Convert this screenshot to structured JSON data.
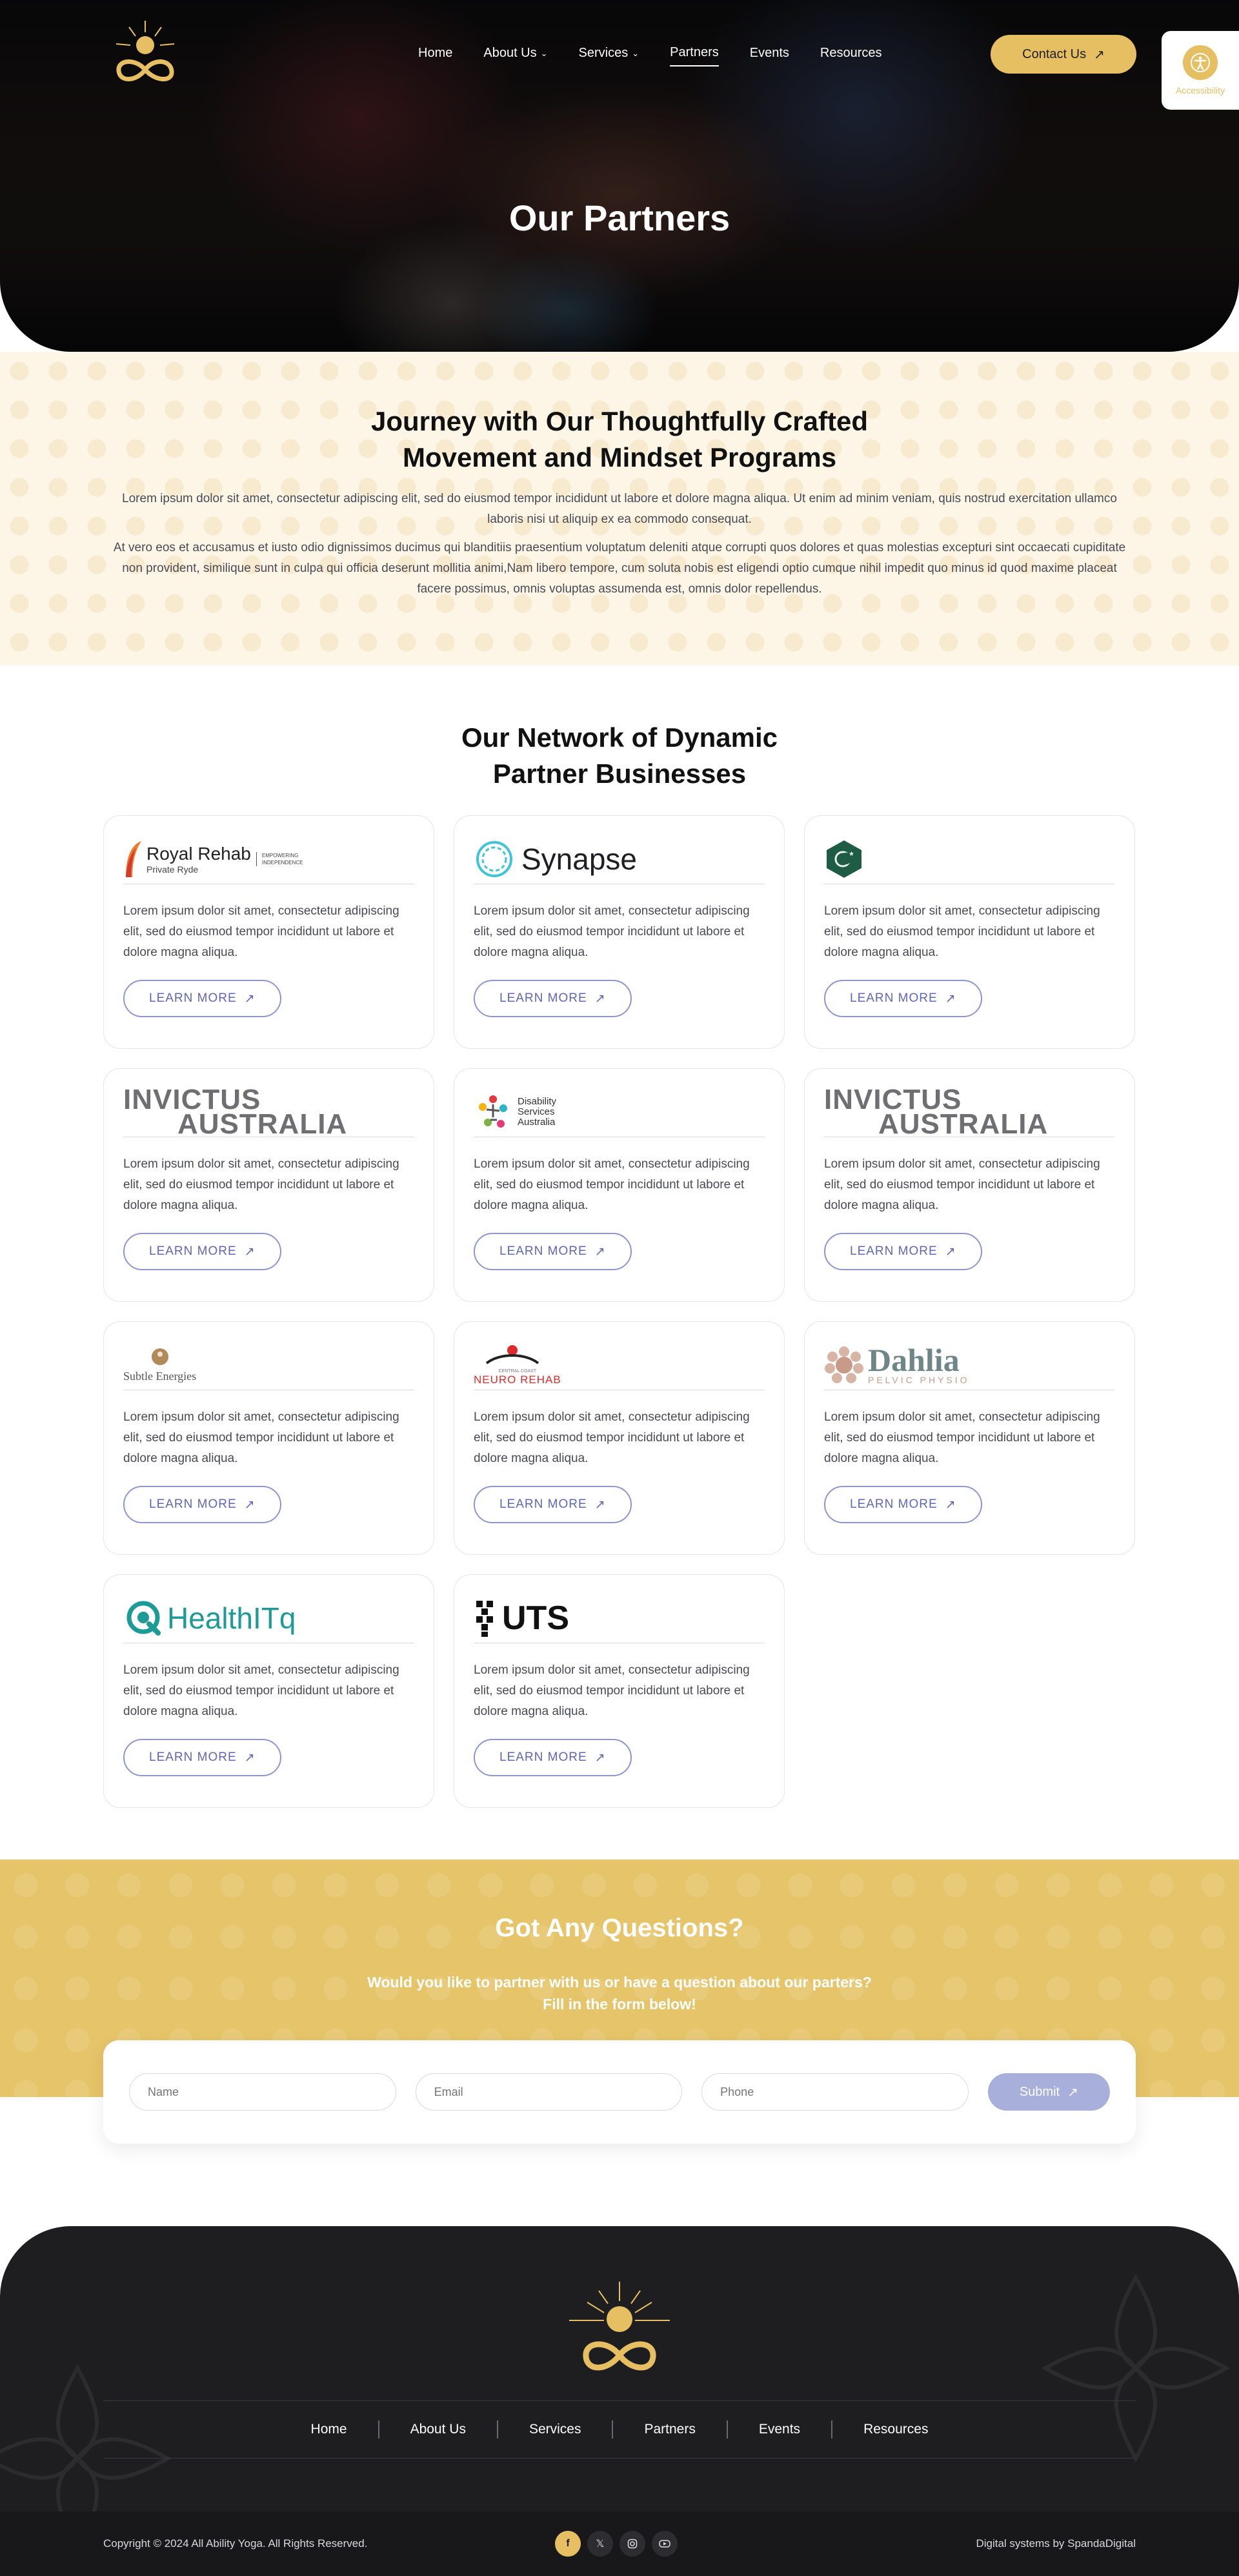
{
  "header": {
    "nav": [
      {
        "label": "Home",
        "dropdown": false,
        "active": false
      },
      {
        "label": "About Us",
        "dropdown": true,
        "active": false
      },
      {
        "label": "Services",
        "dropdown": true,
        "active": false
      },
      {
        "label": "Partners",
        "dropdown": false,
        "active": true
      },
      {
        "label": "Events",
        "dropdown": false,
        "active": false
      },
      {
        "label": "Resources",
        "dropdown": false,
        "active": false
      }
    ],
    "contact_label": "Contact Us",
    "accessibility_label": "Accessibility"
  },
  "hero": {
    "title": "Our Partners"
  },
  "intro": {
    "heading_line1": "Journey with Our Thoughtfully Crafted",
    "heading_line2": "Movement and Mindset Programs",
    "para1": "Lorem ipsum dolor sit amet, consectetur adipiscing elit, sed do eiusmod tempor incididunt ut labore et dolore magna aliqua. Ut enim ad minim veniam, quis nostrud exercitation ullamco laboris nisi ut aliquip ex ea commodo consequat.",
    "para2": "At vero eos et accusamus et iusto odio dignissimos ducimus qui blanditiis praesentium voluptatum deleniti atque corrupti quos dolores et quas molestias excepturi sint occaecati cupiditate non provident, similique sunt in culpa qui officia deserunt mollitia animi,Nam libero tempore, cum soluta nobis est eligendi optio cumque nihil impedit quo minus id quod maxime placeat facere possimus, omnis voluptas assumenda est, omnis dolor repellendus."
  },
  "network": {
    "heading_line1": "Our Network of Dynamic",
    "heading_line2": "Partner Businesses",
    "learn_more": "LEARN MORE",
    "description": "Lorem ipsum dolor sit amet, consectetur adipiscing elit, sed do eiusmod tempor incididunt ut labore et dolore magna aliqua.",
    "partners": [
      {
        "logo_main": "Royal Rehab",
        "logo_sub": "Private Ryde",
        "logo_tag1": "EMPOWERING",
        "logo_tag2": "INDEPENDENCE"
      },
      {
        "logo_main": "Synapse"
      },
      {
        "logo_main": ""
      },
      {
        "logo_main": "INVICTUS",
        "logo_sub": "AUSTRALIA"
      },
      {
        "logo_main": "Disability",
        "logo_sub": "Services",
        "logo_tag1": "Australia"
      },
      {
        "logo_main": "INVICTUS",
        "logo_sub": "AUSTRALIA"
      },
      {
        "logo_main": "Subtle Energies"
      },
      {
        "logo_main": "NEURO REHAB",
        "logo_sub": "CENTRAL COAST"
      },
      {
        "logo_main": "Dahlia",
        "logo_sub": "PELVIC PHYSIO"
      },
      {
        "logo_main": "HealthITq"
      },
      {
        "logo_main": "UTS"
      }
    ]
  },
  "questions": {
    "title": "Got Any Questions?",
    "line1": "Would you like to partner with us or have a question about our parters?",
    "line2": "Fill in the form below!",
    "name_placeholder": "Name",
    "email_placeholder": "Email",
    "phone_placeholder": "Phone",
    "submit_label": "Submit"
  },
  "footer": {
    "nav": [
      "Home",
      "About Us",
      "Services",
      "Partners",
      "Events",
      "Resources"
    ],
    "copyright": "Copyright © 2024 All Ability Yoga. All Rights Reserved.",
    "credits": "Digital systems by SpandaDigital",
    "socials": [
      "facebook-icon",
      "x-icon",
      "instagram-icon",
      "video-icon"
    ]
  },
  "colors": {
    "gold": "#e6bf62",
    "cream": "#fdf6e6",
    "button_outline": "#8e95cf",
    "footer_bg": "#1e1d20"
  }
}
